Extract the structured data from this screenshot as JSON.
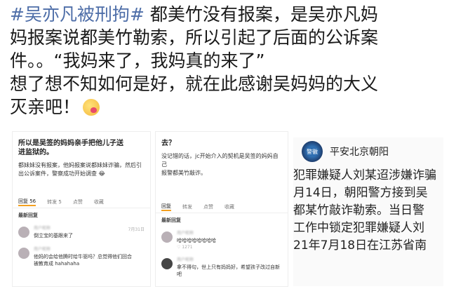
{
  "post": {
    "line1_hashtag": "#吴亦凡被刑拘#",
    "line1_text": " 都美竹没有报案，是吴亦凡妈",
    "line2": "妈报案说都美竹勒索，所以引起了后面的公诉案",
    "line3": "件。。“我妈来了，我妈真的来了”",
    "line4": "想了想不知如何是好，就在此感谢吴妈妈的大义",
    "line5": "灭亲吧！",
    "emoji": "smiling-face-with-heart-emoji"
  },
  "card1": {
    "title_line1": "所以是吴签的妈妈亲手把他儿子送",
    "title_line2": "进监狱的。",
    "body_line1": "都妹妹没有报案，他妈报案说都妹妹诈骗，然后引",
    "body_line2": "出公诉案件，警察成功开始调查 😂",
    "tabs": [
      "回复 56",
      "转发 5",
      "点赞",
      "收藏"
    ],
    "section": "最新回复",
    "comments": [
      {
        "name": "用户昵称",
        "text": "倒立宝的基跟来了",
        "time": "7月31日"
      },
      {
        "name": "用户昵称",
        "text": "他妈的会给他腾时给牛驱吗？总觉得他们回合",
        "text2": "被教育成 hahahaha",
        "time": ""
      }
    ]
  },
  "card2": {
    "title": "去？",
    "body_line1": "没记错的话，jc开始介入的契机是吴签的妈妈自己",
    "body_line2": "报警都美竹敲诈。",
    "tabs": [
      "回复",
      "转发",
      "点赞",
      "收藏"
    ],
    "section": "最新回复",
    "comments": [
      {
        "name": "用户昵称",
        "text": "哈哈哈哈哈哈哈哈",
        "likes": "1271",
        "time": ""
      },
      {
        "name": "用户昵称",
        "text": "拿不得句，世上只有妈妈好，希望孩子改过自新吧",
        "time": ""
      }
    ]
  },
  "card3": {
    "account": "平安北京朝阳",
    "badge_text": "警徽",
    "lines": [
      "犯罪嫌疑人刘某迢涉嫌诈骗",
      "月14日，朝阳警方接到吴",
      "都某竹敲诈勒索。当日警",
      "工作中锁定犯罪嫌疑人刘",
      "21年7月18日在江苏省南"
    ]
  }
}
